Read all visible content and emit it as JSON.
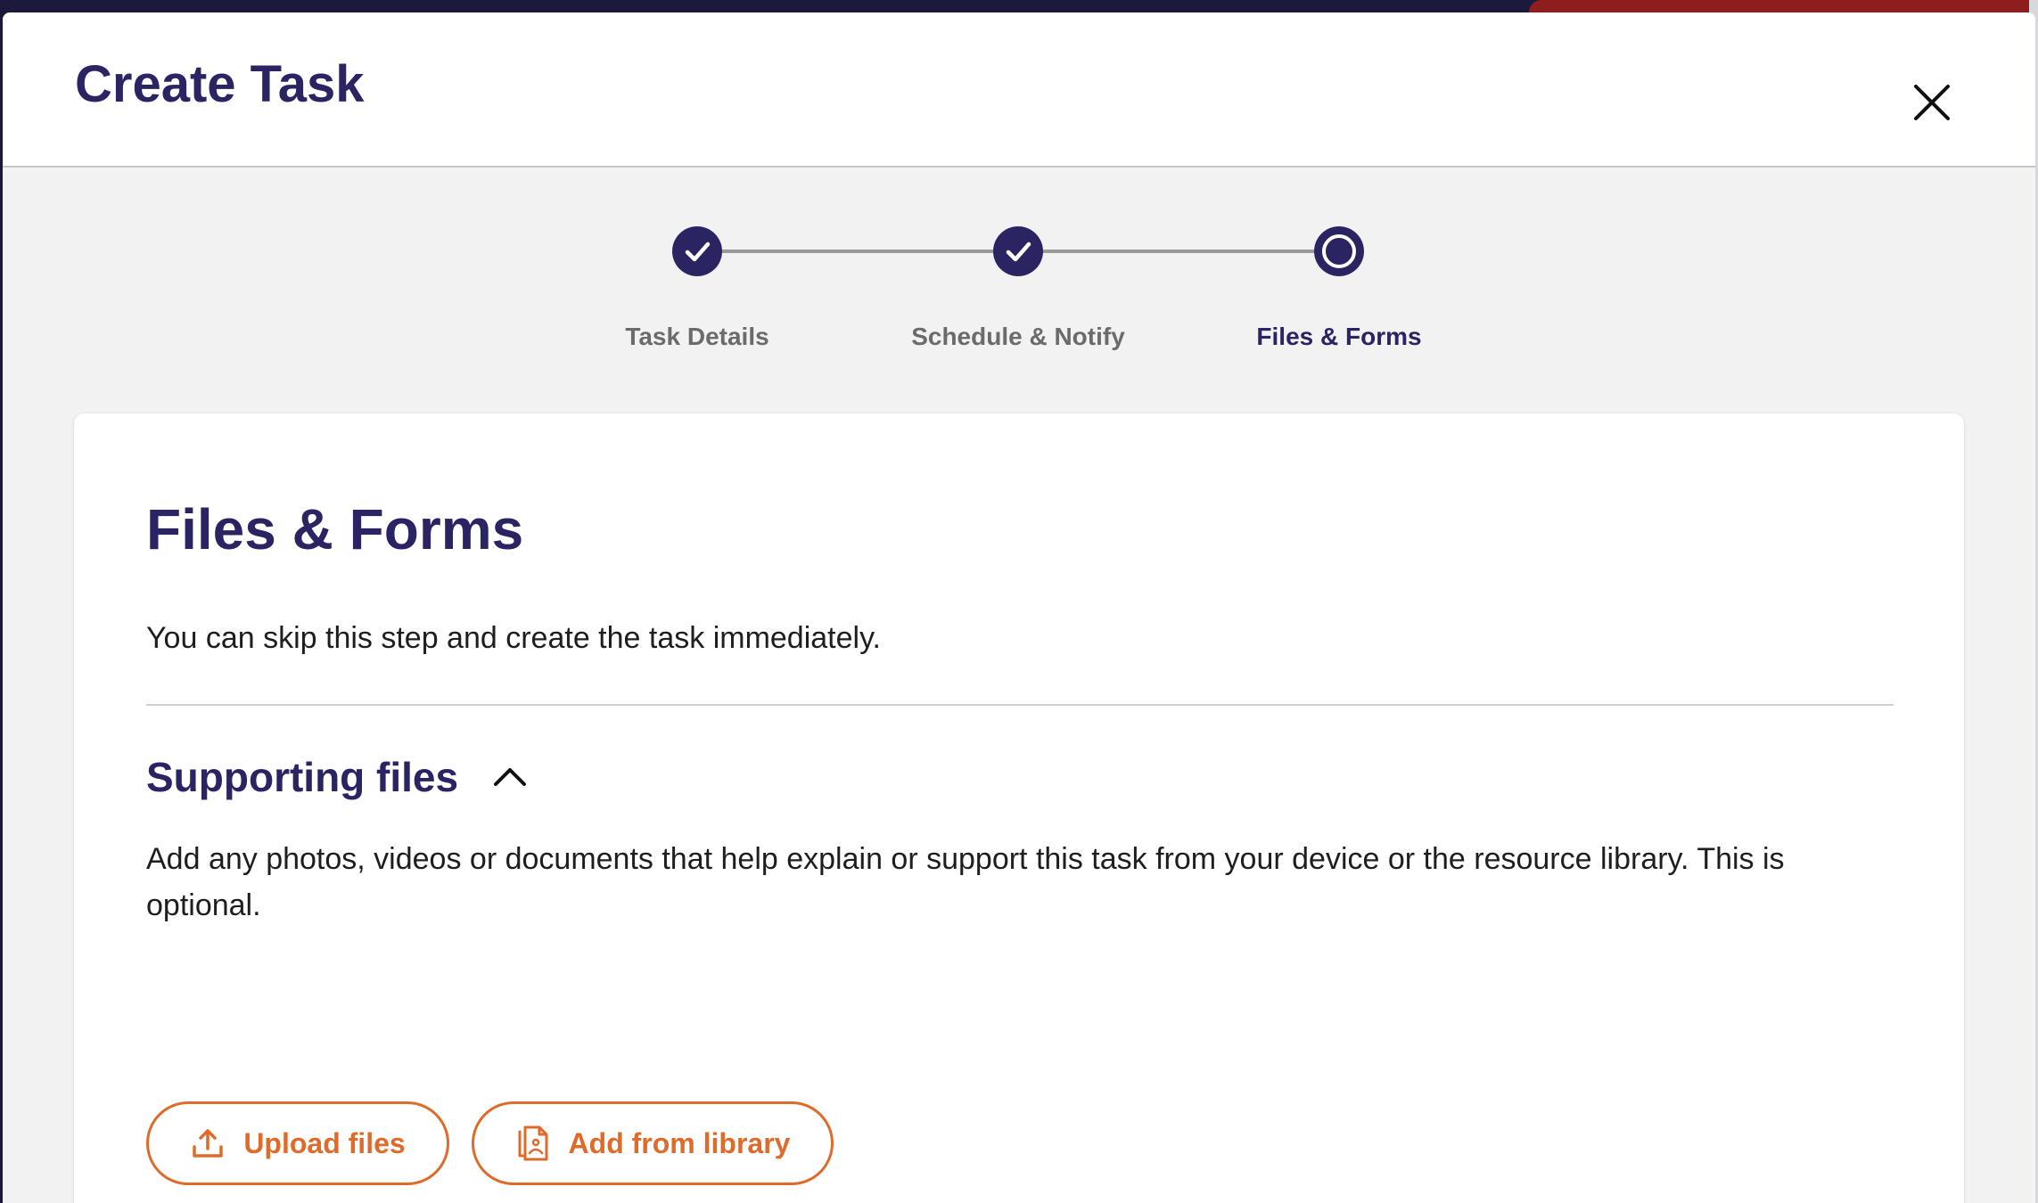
{
  "modal": {
    "title": "Create Task",
    "close_icon": "close-icon"
  },
  "stepper": {
    "steps": [
      {
        "label": "Task Details",
        "state": "completed",
        "icon": "check-icon"
      },
      {
        "label": "Schedule & Notify",
        "state": "completed",
        "icon": "check-icon"
      },
      {
        "label": "Files & Forms",
        "state": "active",
        "icon": "current-step-icon"
      }
    ]
  },
  "card": {
    "title": "Files & Forms",
    "intro": "You can skip this step and create the task immediately.",
    "section": {
      "title": "Supporting files",
      "toggle_icon": "chevron-up-icon",
      "expanded": true,
      "description": "Add any photos, videos or documents that help explain or support this task from your device or the resource library. This is optional."
    },
    "buttons": {
      "upload_label": "Upload files",
      "upload_icon": "upload-icon",
      "library_label": "Add from library",
      "library_icon": "library-icon"
    }
  },
  "colors": {
    "primary": "#2b2463",
    "accent": "#df6b2a",
    "background": "#f2f2f2"
  }
}
